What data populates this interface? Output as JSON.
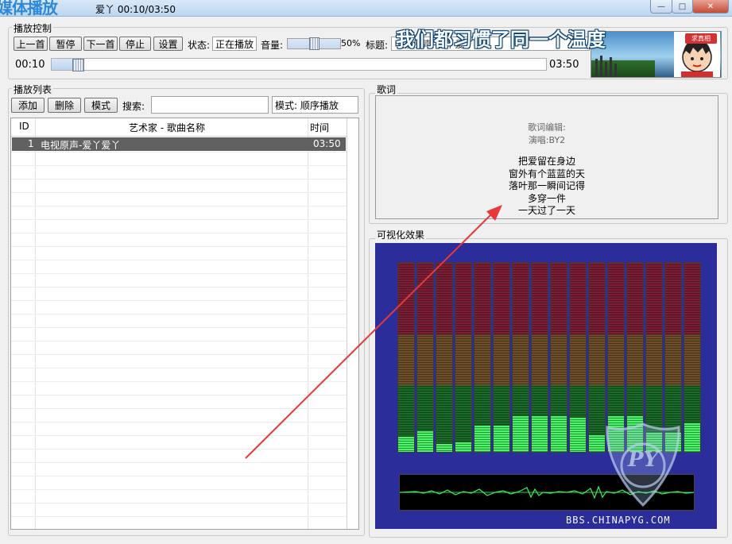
{
  "window": {
    "overlay_title": "媒体播放",
    "title_text": "爱丫 00:10/03:50",
    "minimize_glyph": "—",
    "maximize_glyph": "□",
    "close_glyph": "✕"
  },
  "controls": {
    "group_title": "播放控制",
    "prev_label": "上一首",
    "pause_label": "暂停",
    "next_label": "下一首",
    "stop_label": "停止",
    "settings_label": "设置",
    "status_label": "状态:",
    "status_value": "正在播放",
    "volume_label": "音量:",
    "volume_percent": "50%",
    "volume_level": 0.5,
    "title_label": "标题:",
    "title_value": "电视原声-爱丫爱丫",
    "elapsed": "00:10",
    "total": "03:50",
    "progress_fraction": 0.0435,
    "banner_text": "我们都习惯了同一个温度",
    "avatar_tag": "求真相"
  },
  "playlist": {
    "group_title": "播放列表",
    "add_label": "添加",
    "delete_label": "删除",
    "mode_button_label": "模式",
    "search_label": "搜索:",
    "search_value": "",
    "mode_display": "模式: 顺序播放",
    "columns": {
      "id": "ID",
      "name": "艺术家 - 歌曲名称",
      "time": "时间"
    },
    "rows": [
      {
        "id": "1",
        "name": "电视原声-爱丫爱丫",
        "time": "03:50"
      }
    ]
  },
  "lyrics": {
    "group_title": "歌词",
    "lines": [
      "歌词编辑:",
      "演唱:BY2",
      "",
      "把爱留在身边",
      "窗外有个蓝蓝的天",
      "落叶那一瞬间记得",
      "多穿一件",
      "一天过了一天"
    ]
  },
  "visualizer": {
    "group_title": "可视化效果",
    "bar_levels": [
      0.08,
      0.11,
      0.04,
      0.05,
      0.14,
      0.14,
      0.19,
      0.19,
      0.19,
      0.18,
      0.09,
      0.19,
      0.19,
      0.1,
      0.1,
      0.15
    ],
    "watermark_text": "PY",
    "site_text": "BBS.CHINAPYG.COM"
  },
  "colors": {
    "accent": "#2d89d6",
    "selected_row": "#606060",
    "visualizer_bg": "#2b2d9a",
    "bar_lit": "#4ff06a",
    "arrow": "#e8383a"
  }
}
